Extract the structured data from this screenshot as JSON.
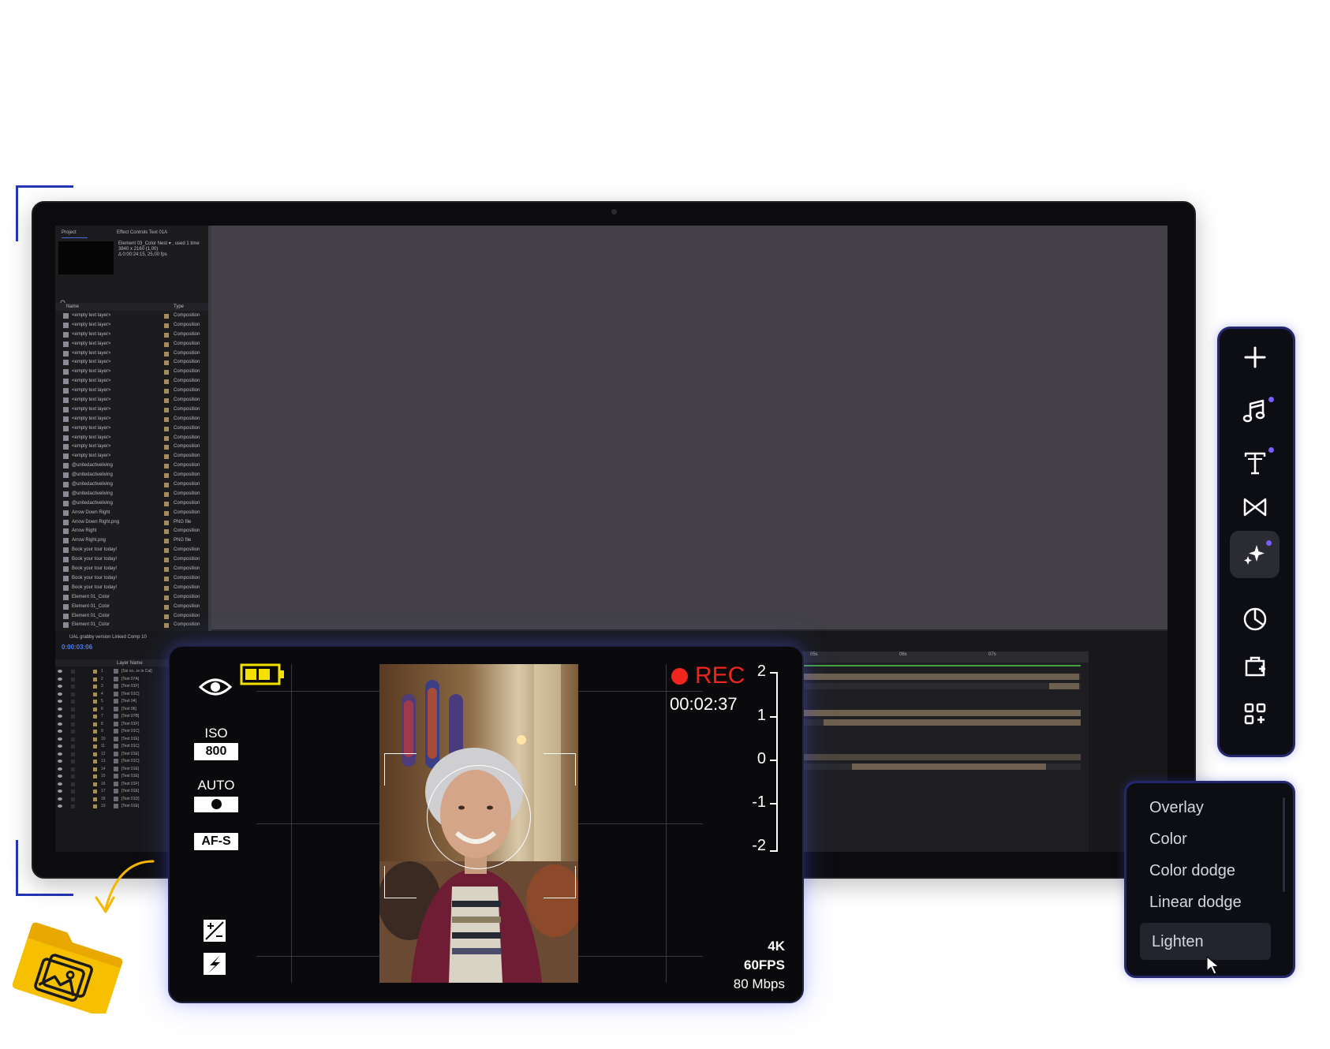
{
  "project_panel": {
    "tab_project": "Project",
    "tab_effect": "Effect Controls Text 01A",
    "meta_lines": [
      "Element 03_Color Nest ▾ , used 1 time",
      "3840 x 2160 (1,00)",
      "Δ 0:00:24:15, 25,00 fps"
    ],
    "column_name": "Name",
    "column_type": "Type",
    "items": [
      {
        "name": "<empty text layer>",
        "type": "Composition"
      },
      {
        "name": "<empty text layer>",
        "type": "Composition"
      },
      {
        "name": "<empty text layer>",
        "type": "Composition"
      },
      {
        "name": "<empty text layer>",
        "type": "Composition"
      },
      {
        "name": "<empty text layer>",
        "type": "Composition"
      },
      {
        "name": "<empty text layer>",
        "type": "Composition"
      },
      {
        "name": "<empty text layer>",
        "type": "Composition"
      },
      {
        "name": "<empty text layer>",
        "type": "Composition"
      },
      {
        "name": "<empty text layer>",
        "type": "Composition"
      },
      {
        "name": "<empty text layer>",
        "type": "Composition"
      },
      {
        "name": "<empty text layer>",
        "type": "Composition"
      },
      {
        "name": "<empty text layer>",
        "type": "Composition"
      },
      {
        "name": "<empty text layer>",
        "type": "Composition"
      },
      {
        "name": "<empty text layer>",
        "type": "Composition"
      },
      {
        "name": "<empty text layer>",
        "type": "Composition"
      },
      {
        "name": "<empty text layer>",
        "type": "Composition"
      },
      {
        "name": "@unitedactiveliving",
        "type": "Composition"
      },
      {
        "name": "@unitedactiveliving",
        "type": "Composition"
      },
      {
        "name": "@unitedactiveliving",
        "type": "Composition"
      },
      {
        "name": "@unitedactiveliving",
        "type": "Composition"
      },
      {
        "name": "@unitedactiveliving",
        "type": "Composition"
      },
      {
        "name": "Arrow Down Right",
        "type": "Composition"
      },
      {
        "name": "Arrow Down Right.png",
        "type": "PNG file"
      },
      {
        "name": "Arrow Right",
        "type": "Composition"
      },
      {
        "name": "Arrow Right.png",
        "type": "PNG file"
      },
      {
        "name": "Book your tour today!",
        "type": "Composition"
      },
      {
        "name": "Book your tour today!",
        "type": "Composition"
      },
      {
        "name": "Book your tour today!",
        "type": "Composition"
      },
      {
        "name": "Book your tour today!",
        "type": "Composition"
      },
      {
        "name": "Book your tour today!",
        "type": "Composition"
      },
      {
        "name": "Element 01_Color",
        "type": "Composition"
      },
      {
        "name": "Element 01_Color",
        "type": "Composition"
      },
      {
        "name": "Element 01_Color",
        "type": "Composition"
      },
      {
        "name": "Element 01_Color",
        "type": "Composition"
      },
      {
        "name": "Element 02_Color",
        "type": "Composition"
      },
      {
        "name": "Element 02_Color Nest",
        "type": "Composition"
      }
    ]
  },
  "timeline": {
    "comp_tab": "UAL grabby version Linked Comp 10",
    "timecode": "0:00:03:06",
    "layer_name_header": "Layer Name",
    "ruler_labels": [
      "05s",
      "06s",
      "07s"
    ],
    "layers": [
      {
        "num": "1",
        "name": "[Six co...ie in Cal]"
      },
      {
        "num": "2",
        "name": "[Text 07A]"
      },
      {
        "num": "3",
        "name": "[Text 01F]"
      },
      {
        "num": "4",
        "name": "[Text 01C]"
      },
      {
        "num": "5",
        "name": "[Text 04]"
      },
      {
        "num": "6",
        "name": "[Text 06]"
      },
      {
        "num": "7",
        "name": "[Text 07B]"
      },
      {
        "num": "8",
        "name": "[Text 01F]"
      },
      {
        "num": "9",
        "name": "[Text 01C]"
      },
      {
        "num": "10",
        "name": "[Text 01E]"
      },
      {
        "num": "11",
        "name": "[Text 01C]"
      },
      {
        "num": "12",
        "name": "[Text 01E]"
      },
      {
        "num": "13",
        "name": "[Text 01C]"
      },
      {
        "num": "14",
        "name": "[Text 01E]"
      },
      {
        "num": "15",
        "name": "[Text 01E]"
      },
      {
        "num": "16",
        "name": "[Text 01F]"
      },
      {
        "num": "17",
        "name": "[Text 01E]"
      },
      {
        "num": "18",
        "name": "[Text 01D]"
      },
      {
        "num": "19",
        "name": "[Text 01E]"
      }
    ]
  },
  "camera": {
    "iso_label": "ISO",
    "iso_value": "800",
    "wb_label": "AUTO",
    "focus_mode": "AF-S",
    "rec_label": "REC",
    "rec_time": "00:02:37",
    "ev_scale": [
      "2",
      "1",
      "0",
      "-1",
      "-2"
    ],
    "resolution": "4K",
    "fps": "60FPS",
    "bitrate": "80 Mbps",
    "icons": [
      "eye-icon",
      "battery-icon",
      "exposure-compensation-icon",
      "flash-icon"
    ]
  },
  "toolbar": {
    "tools": [
      {
        "name": "add-icon",
        "badge": false,
        "active": false
      },
      {
        "name": "music-icon",
        "badge": true,
        "active": false
      },
      {
        "name": "text-icon",
        "badge": true,
        "active": false
      },
      {
        "name": "transition-icon",
        "badge": false,
        "active": false
      },
      {
        "name": "sparkles-icon",
        "badge": true,
        "active": true
      },
      {
        "name": "sticker-icon",
        "badge": false,
        "active": false
      },
      {
        "name": "import-icon",
        "badge": false,
        "active": false
      },
      {
        "name": "add-grid-icon",
        "badge": false,
        "active": false
      }
    ],
    "accent": "#7c5cff",
    "border": "#24276e"
  },
  "blend_menu": {
    "items": [
      "Overlay",
      "Color",
      "Color dodge",
      "Linear dodge",
      "Lighten"
    ],
    "selected": "Lighten"
  },
  "colors": {
    "bracket": "#2536b5",
    "rec_red": "#f0261e",
    "battery_yellow": "#f5e100",
    "folder_yellow": "#f6b700",
    "timecode_blue": "#4d7ef0"
  }
}
